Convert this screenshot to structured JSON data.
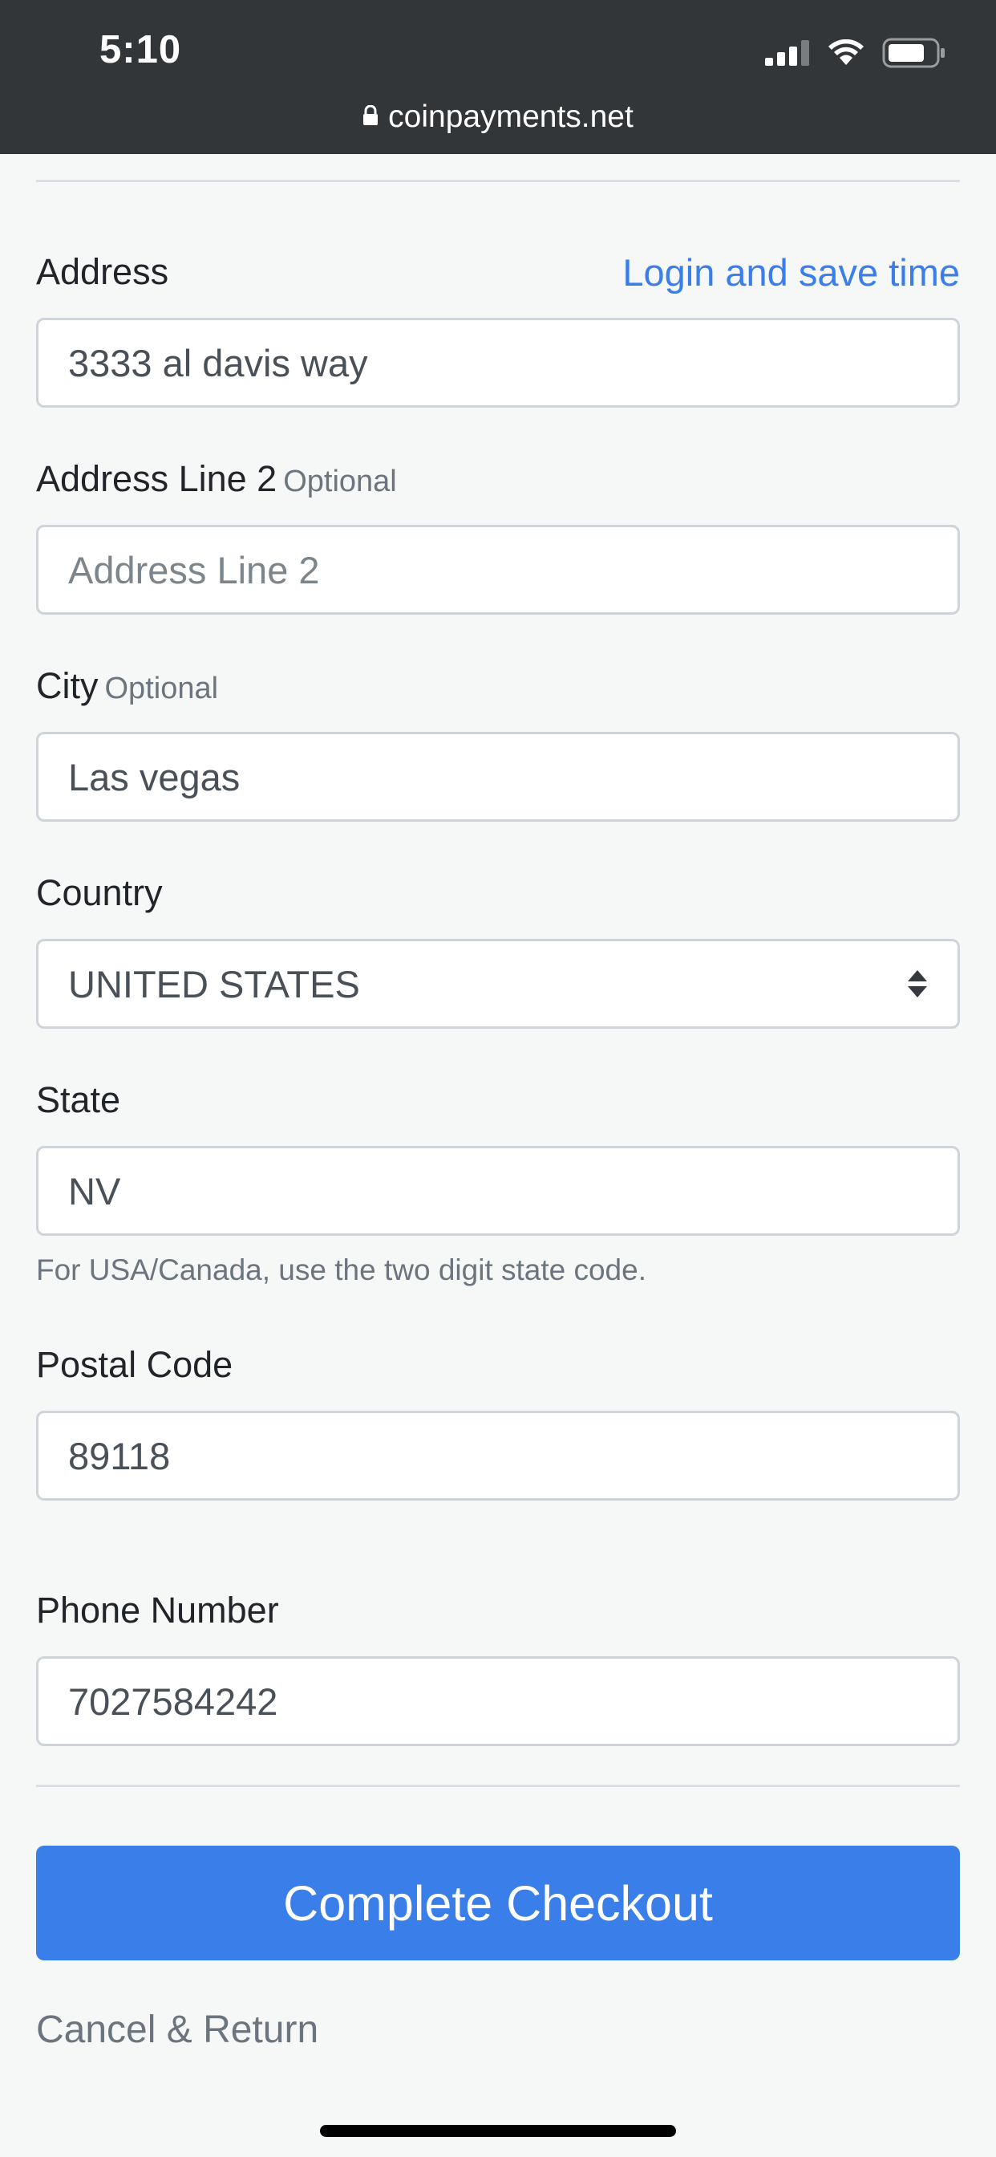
{
  "status_bar": {
    "time": "5:10"
  },
  "browser": {
    "url": "coinpayments.net"
  },
  "form": {
    "address": {
      "label": "Address",
      "value": "3333 al davis way"
    },
    "login_link": "Login and save time",
    "address2": {
      "label": "Address Line 2",
      "optional": "Optional",
      "placeholder": "Address Line 2"
    },
    "city": {
      "label": "City",
      "optional": "Optional",
      "value": "Las vegas"
    },
    "country": {
      "label": "Country",
      "value": "UNITED STATES"
    },
    "state": {
      "label": "State",
      "value": "NV",
      "hint": "For USA/Canada, use the two digit state code."
    },
    "postal": {
      "label": "Postal Code",
      "value": "89118"
    },
    "phone": {
      "label": "Phone Number",
      "value": "7027584242"
    }
  },
  "actions": {
    "complete": "Complete Checkout",
    "cancel": "Cancel & Return"
  },
  "colors": {
    "accent": "#3a7fe9",
    "topbar": "#333639"
  }
}
